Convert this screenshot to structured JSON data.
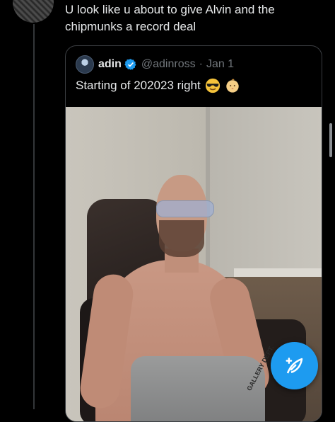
{
  "reply": {
    "text": "U look like u about to give Alvin and the chipmunks a record deal"
  },
  "quoted_tweet": {
    "name": "adin",
    "handle": "@adinross",
    "separator": "·",
    "date": "Jan 1",
    "text": "Starting of 202023 right",
    "emojis": [
      "sunglasses-face",
      "baby-face"
    ],
    "photo_text": "GALLERY DEPT."
  },
  "compose_button": {
    "icon": "compose-feather-icon",
    "color": "#1d9bf0"
  },
  "colors": {
    "background": "#000000",
    "text": "#e7e9ea",
    "secondary": "#71767b",
    "verified": "#1d9bf0"
  }
}
